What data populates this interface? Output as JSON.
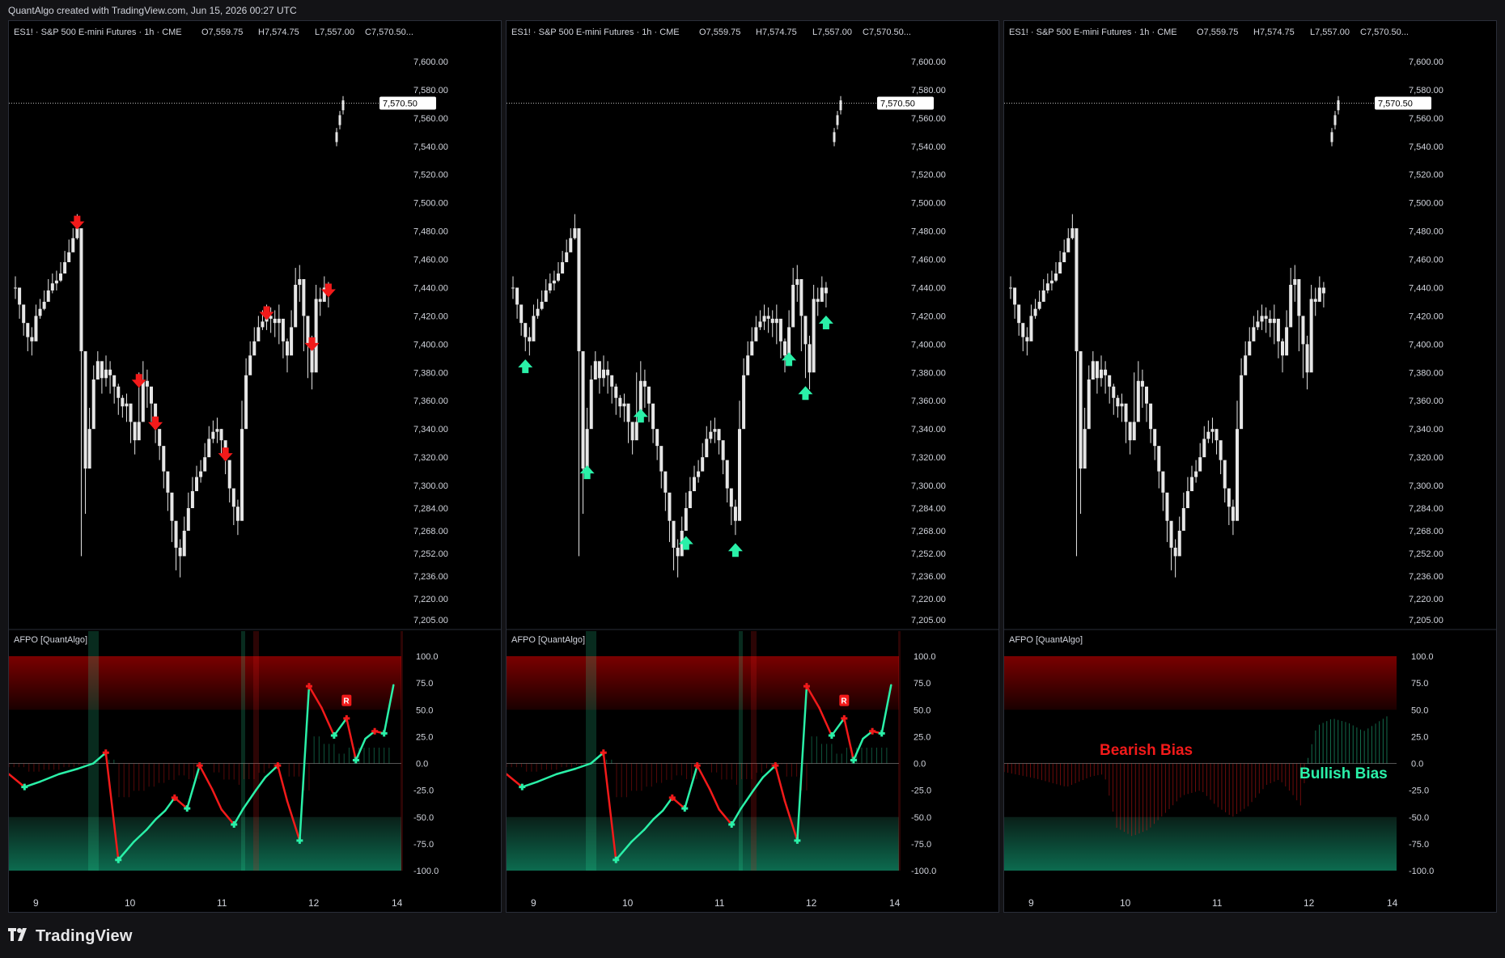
{
  "header": {
    "text": "QuantAlgo created with TradingView.com, Jun 15, 2026 00:27 UTC"
  },
  "footer": {
    "brand": "TradingView",
    "logo_icon": "tradingview-logo-icon"
  },
  "colors": {
    "bull": "#2af0a8",
    "bear": "#f21a1a",
    "candle": "#e6e6e6",
    "background": "#000000",
    "ob_zone": "#7a0000",
    "os_zone": "#0c6b4f"
  },
  "symbol": {
    "legend": "ES1! · S&P 500 E-mini Futures · 1h · CME",
    "open": "O7,559.75",
    "high": "H7,574.75",
    "low": "L7,557.00",
    "close": "C7,570.50...",
    "last_price": "7,570.50"
  },
  "price_axis": [
    "7,600.00",
    "7,580.00",
    "7,560.00",
    "7,540.00",
    "7,520.00",
    "7,500.00",
    "7,480.00",
    "7,460.00",
    "7,440.00",
    "7,420.00",
    "7,400.00",
    "7,380.00",
    "7,360.00",
    "7,340.00",
    "7,320.00",
    "7,300.00",
    "7,284.00",
    "7,268.00",
    "7,252.00",
    "7,236.00",
    "7,220.00",
    "7,205.00"
  ],
  "osc_axis": [
    "100.0",
    "75.0",
    "50.0",
    "25.0",
    "0.0",
    "-25.0",
    "-50.0",
    "-75.0",
    "-100.0"
  ],
  "time_axis": [
    "9",
    "10",
    "11",
    "12",
    "14"
  ],
  "indicator": {
    "name": "AFPO [QuantAlgo]",
    "reversal_label": "R"
  },
  "panels": [
    {
      "id": "bearish-signals",
      "signals": "bear"
    },
    {
      "id": "bullish-signals",
      "signals": "bull"
    },
    {
      "id": "bias",
      "signals": "none",
      "bias_labels": {
        "bearish": "Bearish Bias",
        "bullish": "Bullish Bias"
      }
    }
  ],
  "chart_data": {
    "type": "line",
    "title": "",
    "osc_ylim": [
      -100,
      100
    ],
    "price_ylim": [
      7205,
      7600
    ],
    "oscillator": {
      "x": [
        0,
        5,
        10,
        16,
        22,
        27,
        31,
        35,
        40,
        44,
        47,
        50,
        53,
        57,
        61,
        65,
        68,
        72,
        75,
        79,
        82,
        86,
        89,
        93,
        96,
        100,
        104,
        108
      ],
      "y": [
        -10,
        -22,
        -17,
        -10,
        -5,
        0,
        10,
        -90,
        -73,
        -62,
        -52,
        -44,
        -32,
        -42,
        -2,
        -24,
        -43,
        -57,
        -42,
        -25,
        -13,
        -2,
        -35,
        -72,
        72,
        52,
        26,
        42
      ]
    },
    "oscillator_tail": {
      "x": [
        108,
        111,
        114,
        117,
        120,
        123
      ],
      "y": [
        42,
        3,
        23,
        30,
        28,
        73
      ]
    },
    "histogram_bias": {
      "x": [
        0,
        10,
        20,
        28,
        32,
        36,
        41,
        46,
        52,
        57,
        63,
        68,
        73,
        78,
        84,
        88,
        92,
        95,
        97,
        100,
        105,
        110,
        115,
        123
      ],
      "y": [
        -8,
        -14,
        -22,
        -12,
        -10,
        -60,
        -68,
        -62,
        -45,
        -30,
        -25,
        -40,
        -50,
        -40,
        -20,
        -15,
        -28,
        -40,
        3,
        35,
        42,
        38,
        30,
        45
      ]
    },
    "closes": [
      7440,
      7428,
      7415,
      7405,
      7402,
      7420,
      7425,
      7430,
      7438,
      7443,
      7445,
      7450,
      7458,
      7465,
      7475,
      7482,
      7395,
      7312,
      7340,
      7375,
      7388,
      7376,
      7382,
      7378,
      7370,
      7362,
      7356,
      7358,
      7345,
      7332,
      7345,
      7374,
      7370,
      7358,
      7340,
      7328,
      7310,
      7295,
      7275,
      7256,
      7250,
      7268,
      7284,
      7296,
      7306,
      7310,
      7320,
      7333,
      7338,
      7340,
      7332,
      7318,
      7298,
      7285,
      7275,
      7340,
      7378,
      7392,
      7402,
      7412,
      7416,
      7420,
      7418,
      7415,
      7418,
      7402,
      7392,
      7412,
      7442,
      7446,
      7420,
      7400,
      7380,
      7432,
      7430,
      7440,
      7436
    ],
    "lows": [
      7432,
      7418,
      7406,
      7395,
      7392,
      7410,
      7418,
      7424,
      7432,
      7436,
      7438,
      7444,
      7452,
      7460,
      7468,
      7474,
      7250,
      7280,
      7320,
      7360,
      7375,
      7365,
      7370,
      7365,
      7358,
      7350,
      7348,
      7345,
      7330,
      7322,
      7335,
      7360,
      7355,
      7345,
      7330,
      7318,
      7298,
      7282,
      7260,
      7240,
      7235,
      7255,
      7270,
      7285,
      7298,
      7302,
      7312,
      7325,
      7330,
      7330,
      7322,
      7308,
      7288,
      7272,
      7265,
      7300,
      7360,
      7380,
      7395,
      7404,
      7410,
      7410,
      7408,
      7405,
      7400,
      7390,
      7380,
      7400,
      7430,
      7430,
      7395,
      7376,
      7368,
      7420,
      7420,
      7430,
      7426
    ],
    "highs": [
      7448,
      7436,
      7424,
      7414,
      7412,
      7428,
      7432,
      7438,
      7446,
      7450,
      7452,
      7458,
      7466,
      7474,
      7482,
      7492,
      7410,
      7330,
      7355,
      7385,
      7395,
      7385,
      7392,
      7388,
      7378,
      7372,
      7364,
      7365,
      7354,
      7342,
      7380,
      7388,
      7382,
      7366,
      7350,
      7336,
      7320,
      7305,
      7290,
      7268,
      7262,
      7278,
      7295,
      7306,
      7314,
      7318,
      7330,
      7342,
      7346,
      7348,
      7340,
      7328,
      7308,
      7295,
      7290,
      7360,
      7390,
      7402,
      7412,
      7420,
      7424,
      7428,
      7426,
      7424,
      7428,
      7414,
      7404,
      7424,
      7454,
      7456,
      7432,
      7412,
      7406,
      7442,
      7440,
      7448,
      7444
    ],
    "bear_signal_idx": [
      15,
      30,
      34,
      51,
      61,
      72,
      76
    ],
    "bull_signal_idx": [
      3,
      18,
      31,
      42,
      54,
      67,
      71,
      76
    ],
    "last_candle": {
      "low": 7542,
      "high": 7574.75,
      "close": 7570.5
    }
  }
}
